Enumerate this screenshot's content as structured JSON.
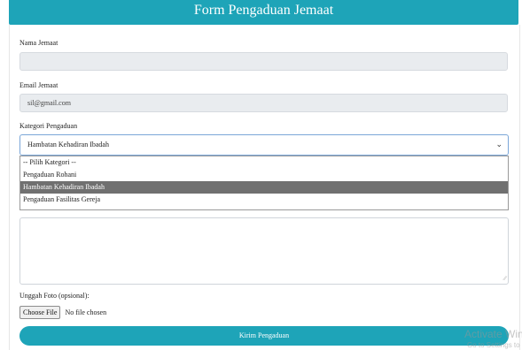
{
  "form": {
    "title": "Form Pengaduan Jemaat",
    "name_label": "Nama Jemaat",
    "name_value": "",
    "email_label": "Email Jemaat",
    "email_value": "sil@gmail.com",
    "category_label": "Kategori Pengaduan",
    "category_selected": "Hambatan Kehadiran Ibadah",
    "category_options": [
      "-- Pilih Kategori --",
      "Pengaduan Rohani",
      "Hambatan Kehadiran Ibadah",
      "Pengaduan Fasilitas Gereja"
    ],
    "photo_label": "Unggah Foto (opsional):",
    "file_button": "Choose File",
    "file_status": "No file chosen",
    "submit_label": "Kirim Pengaduan"
  },
  "watermark": {
    "line1": "Activate Win",
    "line2": "Go to Settings to"
  },
  "colors": {
    "accent": "#1ea4b8",
    "highlight": "#707070"
  },
  "icons": {
    "select_chevron": "chevron-down-icon",
    "resize_grip": "resize-grip-icon"
  }
}
